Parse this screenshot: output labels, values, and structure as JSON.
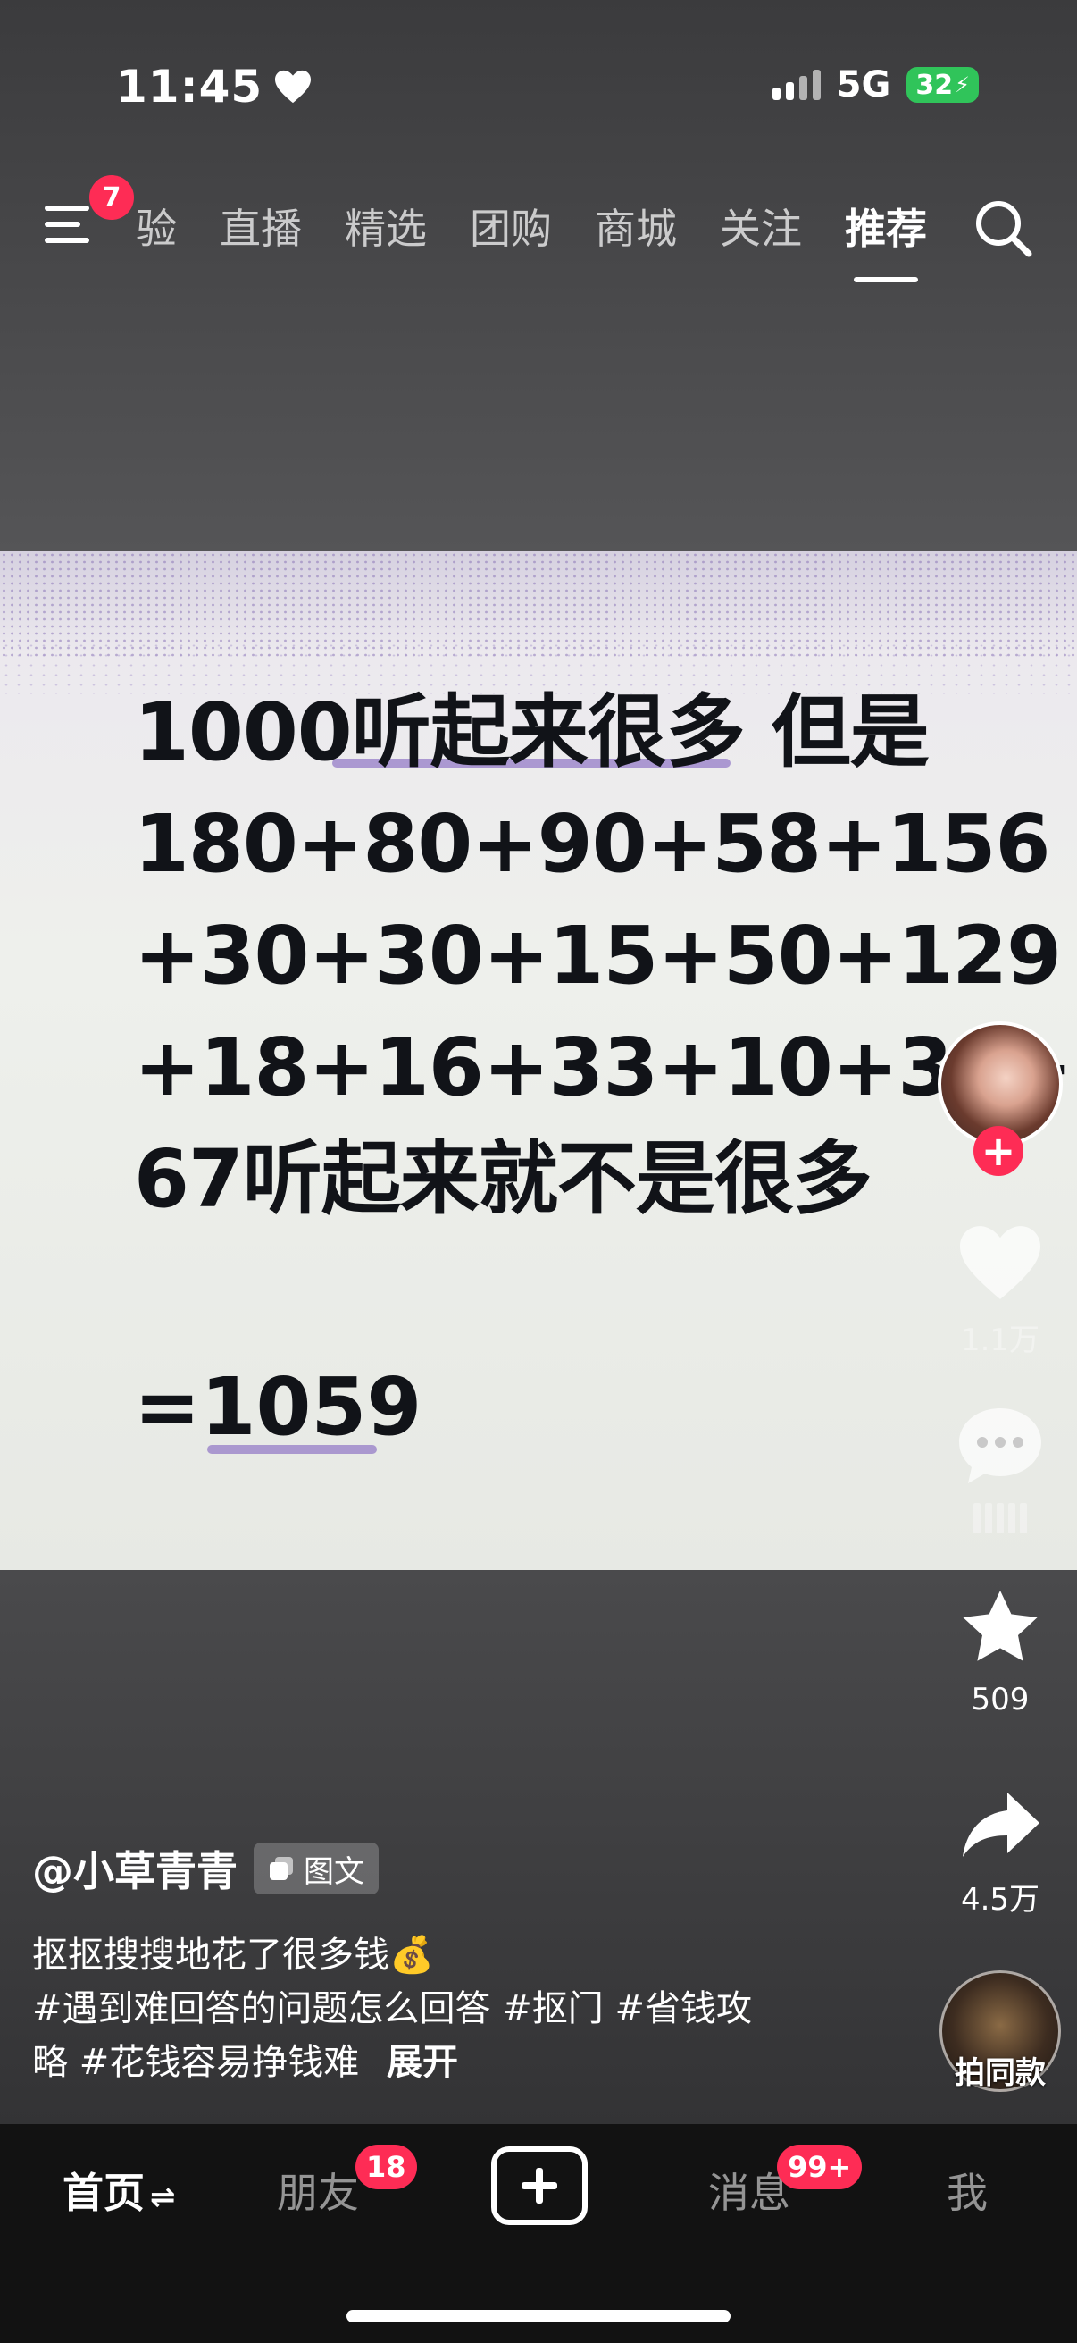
{
  "status_bar": {
    "time": "11:45",
    "network": "5G",
    "battery": "32"
  },
  "top_nav": {
    "menu_badge": "7",
    "tabs": [
      "验",
      "直播",
      "精选",
      "团购",
      "商城",
      "关注",
      "推荐"
    ],
    "active_tab": "推荐"
  },
  "post": {
    "lines": [
      "1000听起来很多 但是",
      "180+80+90+58+156",
      "+30+30+15+50+129",
      "+18+16+33+10+38+",
      "67听起来就不是很多"
    ],
    "total": "=1059"
  },
  "actions": {
    "likes": "1.1万",
    "favorites": "509",
    "shares": "4.5万",
    "remix_label": "拍同款"
  },
  "caption": {
    "author": "@小草青青",
    "type_chip": "图文",
    "line1": "抠抠搜搜地花了很多钱💰",
    "line2": "#遇到难回答的问题怎么回答 #抠门 #省钱攻",
    "line3": "略 #花钱容易挣钱难",
    "expand": "展开"
  },
  "tabbar": {
    "home": "首页",
    "home_suffix": "⇌",
    "friends": "朋友",
    "friends_badge": "18",
    "messages": "消息",
    "messages_badge": "99+",
    "me": "我"
  },
  "colors": {
    "badge": "#fe2c55",
    "battery": "#30c45a",
    "underline": "#9a83c9"
  }
}
